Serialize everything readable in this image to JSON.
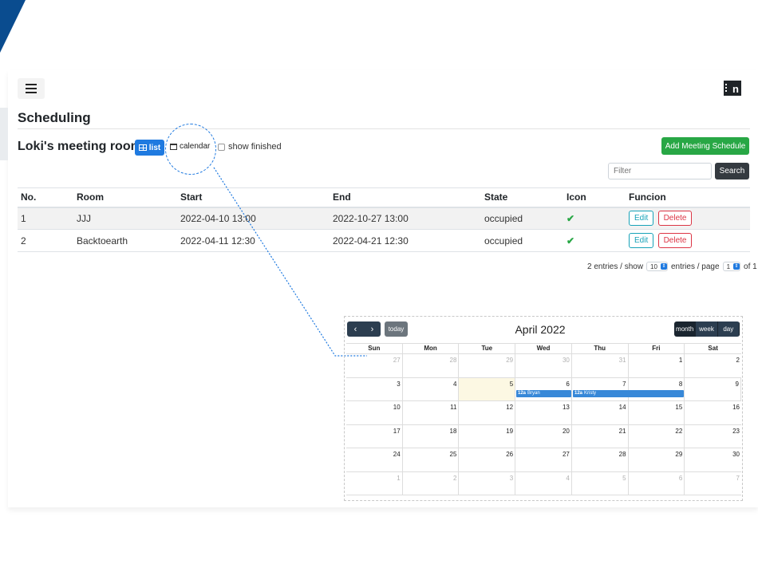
{
  "header": {
    "menu_icon": "hamburger-icon",
    "brand_text": "n",
    "brand_icon": "building-icon"
  },
  "page_title": "Scheduling",
  "room_title": "Loki's meeting room",
  "view_toggle": {
    "list_label": "list",
    "calendar_label": "calendar"
  },
  "show_finished_label": "show finished",
  "add_button_label": "Add Meeting Schedule",
  "filter": {
    "placeholder": "Filter",
    "search_label": "Search"
  },
  "table": {
    "columns": [
      "No.",
      "Room",
      "Start",
      "End",
      "State",
      "Icon",
      "Funcion"
    ],
    "rows": [
      {
        "no": "1",
        "room": "JJJ",
        "start": "2022-04-10 13:00",
        "end": "2022-10-27 13:00",
        "state": "occupied",
        "icon": "✔",
        "edit": "Edit",
        "delete": "Delete"
      },
      {
        "no": "2",
        "room": "Backtoearth",
        "start": "2022-04-11 12:30",
        "end": "2022-04-21 12:30",
        "state": "occupied",
        "icon": "✔",
        "edit": "Edit",
        "delete": "Delete"
      }
    ]
  },
  "pager": {
    "prefix": "2 entries / show",
    "page_size": "10",
    "middle": "entries / page",
    "page": "1",
    "suffix": "of 1"
  },
  "calendar": {
    "prev": "‹",
    "next": "›",
    "today_label": "today",
    "title": "April 2022",
    "views": [
      "month",
      "week",
      "day"
    ],
    "day_names": [
      "Sun",
      "Mon",
      "Tue",
      "Wed",
      "Thu",
      "Fri",
      "Sat"
    ],
    "weeks": [
      [
        "27",
        "28",
        "29",
        "30",
        "31",
        "1",
        "2"
      ],
      [
        "3",
        "4",
        "5",
        "6",
        "7",
        "8",
        "9"
      ],
      [
        "10",
        "11",
        "12",
        "13",
        "14",
        "15",
        "16"
      ],
      [
        "17",
        "18",
        "19",
        "20",
        "21",
        "22",
        "23"
      ],
      [
        "24",
        "25",
        "26",
        "27",
        "28",
        "29",
        "30"
      ],
      [
        "1",
        "2",
        "3",
        "4",
        "5",
        "6",
        "7"
      ]
    ],
    "events": [
      {
        "time": "12a",
        "name": "Bryan"
      },
      {
        "time": "12a",
        "name": "Kristy"
      }
    ],
    "colors": {
      "event": "#3788d8",
      "today": "#fcf8e3",
      "toolbar": "#2c3e50"
    }
  },
  "colors": {
    "primary": "#1f7ae0",
    "success": "#28a745",
    "danger": "#dc3545",
    "info": "#17a2b8",
    "dark": "#343a40",
    "corner": "#0a4c8f"
  }
}
